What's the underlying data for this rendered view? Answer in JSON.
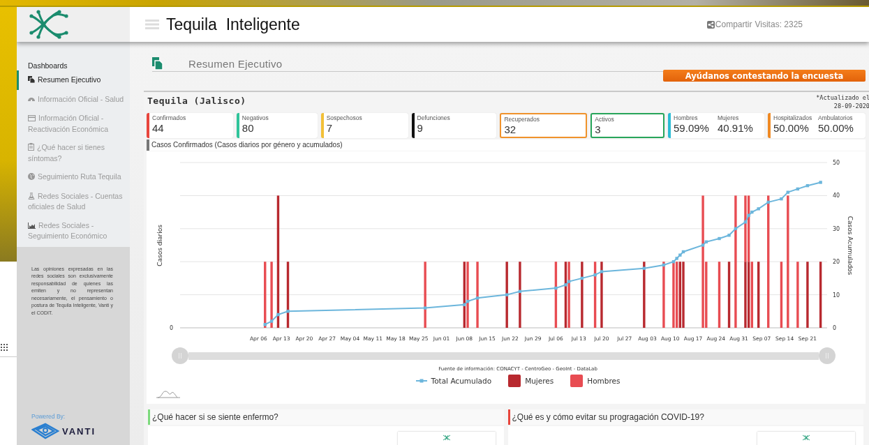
{
  "header": {
    "title": "Tequila  Inteligente",
    "share": "Compartir",
    "visits": "Visitas: 2325"
  },
  "sidebar": {
    "heading": "Dashboards",
    "items": [
      {
        "label": "Resumen Ejecutivo",
        "selected": true
      },
      {
        "label": "Información Oficial - Salud",
        "selected": false
      },
      {
        "label": "Información Oficial - Reactivación Económica",
        "selected": false
      },
      {
        "label": "¿Qué hacer si tienes síntomas?",
        "selected": false
      },
      {
        "label": "Seguimiento Ruta Tequila",
        "selected": false
      },
      {
        "label": "Redes Sociales - Cuentas oficiales de Salud",
        "selected": false
      },
      {
        "label": "Redes Sociales - Seguimiento Económico",
        "selected": false
      }
    ],
    "disclaimer": "Las opiniones expresadas en las redes sociales son exclusivamente responsabilidad de quienes las emiten y no representan necesariamente, el pensamiento o postura de Tequila Inteligente, Vanti y el CODIT.",
    "powered_by": "Powered By:",
    "brand": "VANTI"
  },
  "page_header": {
    "title": "Resumen Ejecutivo",
    "survey_button": "Ayúdanos contestando la encuesta"
  },
  "summary": {
    "title": "Tequila (Jalisco)",
    "updated": "*Actualizado el 28-09-2020",
    "cards": [
      {
        "kind": "bar",
        "color": "#e8453c",
        "metrics": [
          {
            "label": "Confirmados",
            "value": "44"
          }
        ]
      },
      {
        "kind": "bar",
        "color": "#2fc49a",
        "metrics": [
          {
            "label": "Negativos",
            "value": "80"
          }
        ]
      },
      {
        "kind": "bar",
        "color": "#f2c037",
        "metrics": [
          {
            "label": "Sospechosos",
            "value": "7"
          }
        ]
      },
      {
        "kind": "bar",
        "color": "#111111",
        "metrics": [
          {
            "label": "Defunciones",
            "value": "9"
          }
        ]
      },
      {
        "kind": "outline",
        "color": "#f0922b",
        "metrics": [
          {
            "label": "Recuperados",
            "value": "32"
          }
        ]
      },
      {
        "kind": "outline",
        "color": "#27a55a",
        "metrics": [
          {
            "label": "Activos",
            "value": "3"
          }
        ]
      },
      {
        "kind": "bar",
        "color": "#2bbcd4",
        "metrics": [
          {
            "label": "Hombres",
            "value": "59.09%"
          },
          {
            "label": "Mujeres",
            "value": "40.91%"
          }
        ]
      },
      {
        "kind": "bar",
        "color": "#f08a24",
        "metrics": [
          {
            "label": "Hospitalizados",
            "value": "50.00%"
          },
          {
            "label": "Ambulatorios",
            "value": "50.00%"
          }
        ]
      }
    ]
  },
  "chart_panel": {
    "title": "Casos Confirmados (Casos diarios por género y acumulados)",
    "left_axis_title": "Casos diarios",
    "left_tick": "0",
    "right_axis_title": "Casos Acumulados",
    "right_ticks": [
      "50",
      "40",
      "30",
      "20",
      "10",
      "0"
    ],
    "date_labels": [
      "Apr 06",
      "Apr 13",
      "Apr 20",
      "Apr 27",
      "May 04",
      "May 11",
      "May 18",
      "May 25",
      "Jun 01",
      "Jun 08",
      "Jun 15",
      "Jun 22",
      "Jun 29",
      "Jul 06",
      "Jul 13",
      "Jul 20",
      "Jul 27",
      "Aug 03",
      "Aug 10",
      "Aug 17",
      "Aug 24",
      "Aug 31",
      "Sep 07",
      "Sep 14",
      "Sep 21"
    ],
    "source": "Fuente de información: CONACYT - CentroGeo - GeoInt - DataLab",
    "legend": [
      {
        "name": "Total Acumulado",
        "kind": "line",
        "color": "#6cb6dc"
      },
      {
        "name": "Mujeres",
        "kind": "bar",
        "color": "#b8292f"
      },
      {
        "name": "Hombres",
        "kind": "bar",
        "color": "#e84c52"
      }
    ]
  },
  "info_cards": [
    {
      "title": "¿Qué hacer si se siente enfermo?",
      "color": "#7dda7d"
    },
    {
      "title": "¿Qué es y cómo evitar su progragación COVID-19?",
      "color": "#e8453c"
    }
  ]
}
